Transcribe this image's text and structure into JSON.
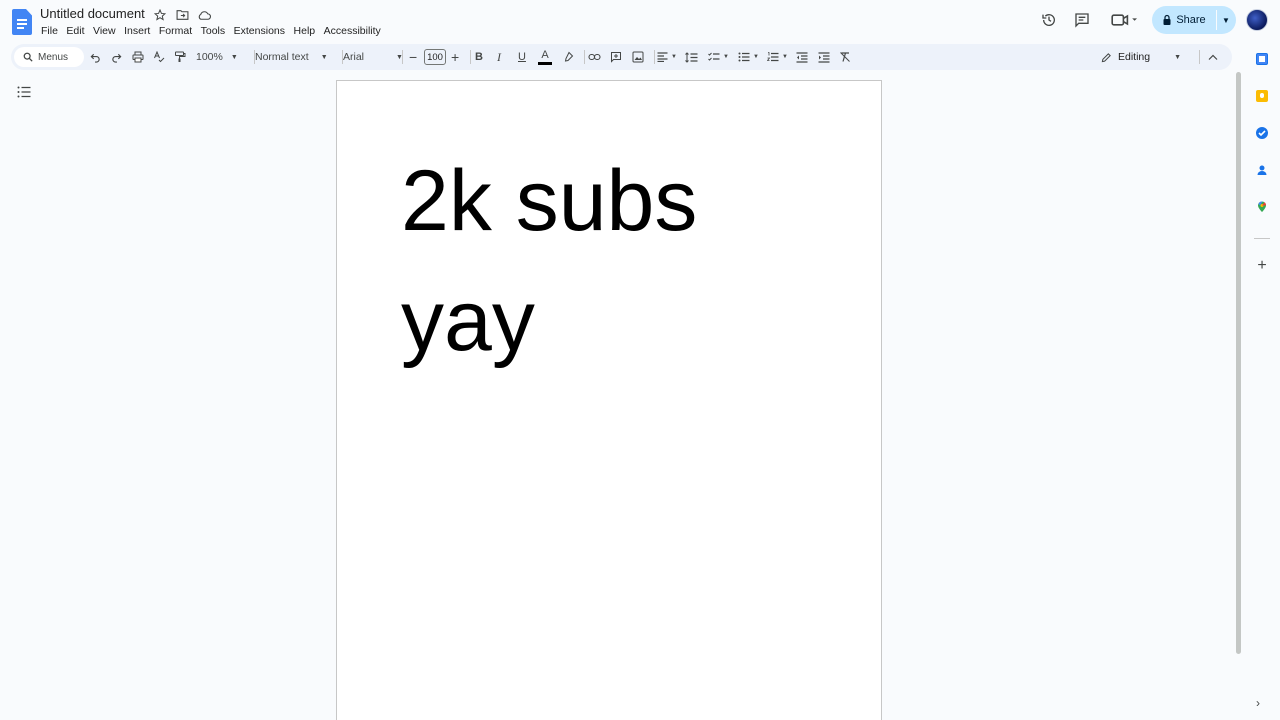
{
  "app": {
    "title": "Untitled document",
    "menu": [
      "File",
      "Edit",
      "View",
      "Insert",
      "Format",
      "Tools",
      "Extensions",
      "Help",
      "Accessibility"
    ]
  },
  "header": {
    "share_label": "Share",
    "icons": [
      "version-history-icon",
      "comments-icon",
      "meet-icon",
      "lock-icon",
      "avatar"
    ]
  },
  "toolbar": {
    "search_placeholder": "Menus",
    "zoom": "100%",
    "style": "Normal text",
    "font": "Arial",
    "font_size": "100",
    "mode": "Editing"
  },
  "document": {
    "line1": "2k subs",
    "line2": "yay"
  },
  "colors": {
    "accent": "#4285f4",
    "share_bg": "#c2e7ff",
    "toolbar_bg": "#edf2fa",
    "page_bg": "#ffffff",
    "canvas_bg": "#f9fbfd",
    "text_color_underline": "#000000"
  },
  "sidepanel": {
    "icons": [
      "calendar-icon",
      "keep-icon",
      "tasks-icon",
      "contacts-icon",
      "maps-icon",
      "add-icon"
    ]
  }
}
